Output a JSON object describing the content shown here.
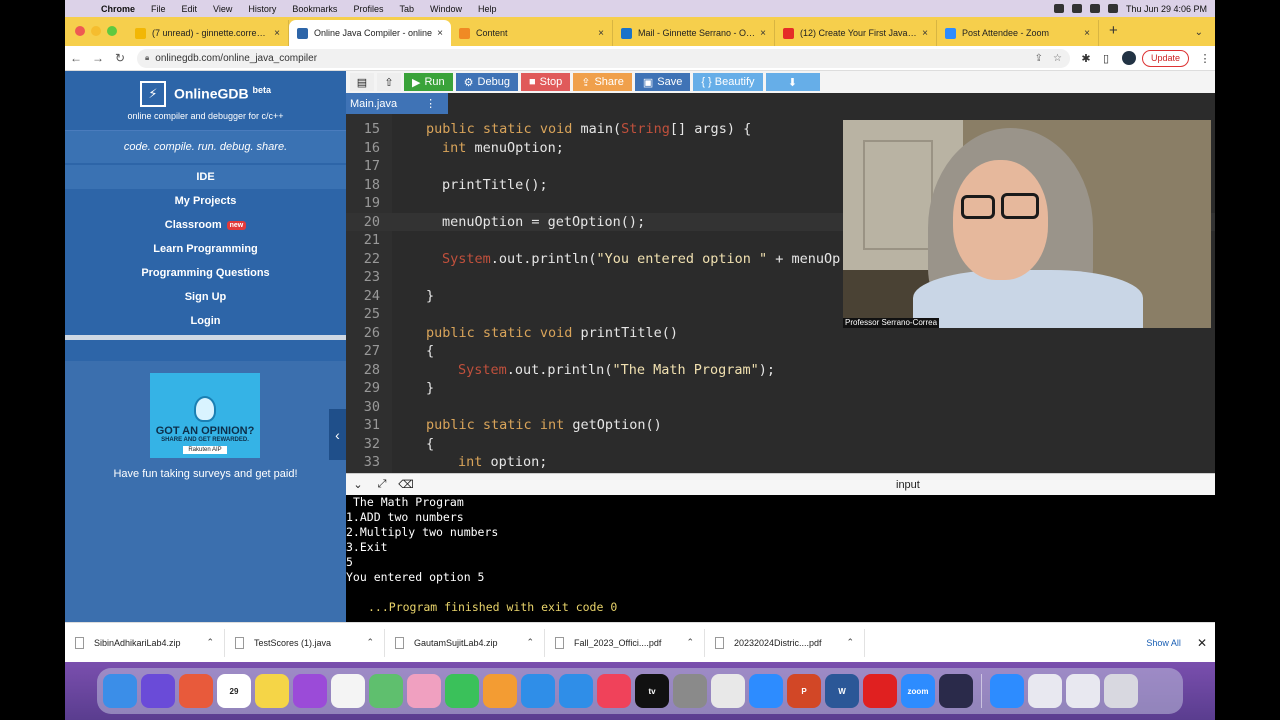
{
  "menubar": {
    "items": [
      "Chrome",
      "File",
      "Edit",
      "View",
      "History",
      "Bookmarks",
      "Profiles",
      "Tab",
      "Window",
      "Help"
    ],
    "clock": "Thu Jun 29  4:06 PM"
  },
  "tabs": [
    {
      "title": "(7 unread) - ginnette.correa@",
      "icon": "mail-icon",
      "color": "#f2b705"
    },
    {
      "title": "Online Java Compiler - online",
      "icon": "gdb-icon",
      "color": "#2d65a8"
    },
    {
      "title": "Content",
      "icon": "pencil-icon",
      "color": "#f08a24"
    },
    {
      "title": "Mail - Ginnette Serrano - Outlo",
      "icon": "outlook-icon",
      "color": "#1a73c9"
    },
    {
      "title": "(12) Create Your First Java Pro",
      "icon": "youtube-icon",
      "color": "#e52d27"
    },
    {
      "title": "Post Attendee - Zoom",
      "icon": "zoom-icon",
      "color": "#2d8cff"
    }
  ],
  "address": {
    "url": "onlinegdb.com/online_java_compiler",
    "update_label": "Update"
  },
  "sidebar": {
    "brand": "OnlineGDB",
    "beta": "beta",
    "tagline": "online compiler and debugger for c/c++",
    "motto": "code. compile. run. debug. share.",
    "nav": [
      {
        "label": "IDE"
      },
      {
        "label": "My Projects"
      },
      {
        "label": "Classroom",
        "badge": "new"
      },
      {
        "label": "Learn Programming"
      },
      {
        "label": "Programming Questions"
      },
      {
        "label": "Sign Up"
      },
      {
        "label": "Login"
      }
    ],
    "ad": {
      "headline": "GOT AN OPINION?",
      "sub": "SHARE AND GET REWARDED.",
      "brand": "Rakuten AIP",
      "text": "Have fun taking surveys and get paid!"
    }
  },
  "toolbar": {
    "run": "Run",
    "debug": "Debug",
    "stop": "Stop",
    "share": "Share",
    "save": "Save",
    "beautify": "{ } Beautify",
    "colors": {
      "run": "#3aa33a",
      "debug": "#3f73b6",
      "stop": "#e05a5a",
      "share": "#f0a04b",
      "save": "#3f73b6",
      "beautify": "#66aee8",
      "download": "#66aee8"
    }
  },
  "file_tab": "Main.java",
  "code_lines": [
    {
      "n": "15",
      "indent": 0,
      "text": "public static void main(String[] args) {"
    },
    {
      "n": "16",
      "indent": 1,
      "text": "int menuOption;"
    },
    {
      "n": "17",
      "indent": 0,
      "text": ""
    },
    {
      "n": "18",
      "indent": 1,
      "text": "printTitle();"
    },
    {
      "n": "19",
      "indent": 0,
      "text": ""
    },
    {
      "n": "20",
      "indent": 1,
      "text": "menuOption = getOption();"
    },
    {
      "n": "21",
      "indent": 0,
      "text": ""
    },
    {
      "n": "22",
      "indent": 1,
      "text": "System.out.println(\"You entered option \" + menuOp"
    },
    {
      "n": "23",
      "indent": 0,
      "text": ""
    },
    {
      "n": "24",
      "indent": 0,
      "text": "}"
    },
    {
      "n": "25",
      "indent": 0,
      "text": ""
    },
    {
      "n": "26",
      "indent": 0,
      "text": "public static void printTitle()"
    },
    {
      "n": "27",
      "indent": 0,
      "text": "{"
    },
    {
      "n": "28",
      "indent": 2,
      "text": "System.out.println(\"The Math Program\");"
    },
    {
      "n": "29",
      "indent": 0,
      "text": "}"
    },
    {
      "n": "30",
      "indent": 0,
      "text": ""
    },
    {
      "n": "31",
      "indent": 0,
      "text": "public static int getOption()"
    },
    {
      "n": "32",
      "indent": 0,
      "text": "{"
    },
    {
      "n": "33",
      "indent": 2,
      "text": "int option;"
    }
  ],
  "output": {
    "label": "input",
    "lines": [
      "The Math Program",
      "1.ADD two numbers",
      "2.Multiply two numbers",
      "3.Exit",
      "5",
      "You entered option 5"
    ],
    "finished": "...Program finished with exit code 0"
  },
  "webcam": {
    "name": "Professor Serrano-Correa"
  },
  "downloads": [
    "SibinAdhikariLab4.zip",
    "TestScores (1).java",
    "GautamSujitLab4.zip",
    "Fall_2023_Offici....pdf",
    "20232024Distric....pdf"
  ],
  "show_all": "Show All",
  "dock": [
    {
      "name": "finder-icon",
      "color": "#3b8ee8",
      "label": ""
    },
    {
      "name": "siri-icon",
      "color": "#6a4bd8",
      "label": ""
    },
    {
      "name": "launchpad-icon",
      "color": "#e85a3b",
      "label": ""
    },
    {
      "name": "calendar-icon",
      "color": "#ffffff",
      "label": "29"
    },
    {
      "name": "notes-icon",
      "color": "#f5d547",
      "label": ""
    },
    {
      "name": "podcasts-icon",
      "color": "#9b4bd8",
      "label": ""
    },
    {
      "name": "reminders-icon",
      "color": "#f4f4f4",
      "label": ""
    },
    {
      "name": "maps-icon",
      "color": "#5fbf6e",
      "label": ""
    },
    {
      "name": "photos-icon",
      "color": "#f0a0c0",
      "label": ""
    },
    {
      "name": "facetime-icon",
      "color": "#3ac15a",
      "label": ""
    },
    {
      "name": "pages-icon",
      "color": "#f39c33",
      "label": ""
    },
    {
      "name": "keynote-icon",
      "color": "#2f8ee8",
      "label": ""
    },
    {
      "name": "appstore-icon",
      "color": "#2f8ee8",
      "label": ""
    },
    {
      "name": "music-icon",
      "color": "#f0425a",
      "label": ""
    },
    {
      "name": "appletv-icon",
      "color": "#111111",
      "label": "tv"
    },
    {
      "name": "settings-icon",
      "color": "#8a8a8a",
      "label": ""
    },
    {
      "name": "chrome-icon",
      "color": "#e8e8e8",
      "label": ""
    },
    {
      "name": "zoom-meeting-icon",
      "color": "#2d8cff",
      "label": ""
    },
    {
      "name": "powerpoint-icon",
      "color": "#d24726",
      "label": "P"
    },
    {
      "name": "word-icon",
      "color": "#2b5797",
      "label": "W"
    },
    {
      "name": "acrobat-icon",
      "color": "#e02020",
      "label": ""
    },
    {
      "name": "zoom-app-icon",
      "color": "#2d8cff",
      "label": "zoom"
    },
    {
      "name": "blackboard-icon",
      "color": "#2a2a4a",
      "label": ""
    },
    {
      "name": "zoom-minimized-icon",
      "color": "#2d8cff",
      "label": ""
    },
    {
      "name": "window-thumb-1-icon",
      "color": "#e8e8f0",
      "label": ""
    },
    {
      "name": "window-thumb-2-icon",
      "color": "#e8e8f0",
      "label": ""
    },
    {
      "name": "trash-icon",
      "color": "#d8d8e0",
      "label": ""
    }
  ]
}
